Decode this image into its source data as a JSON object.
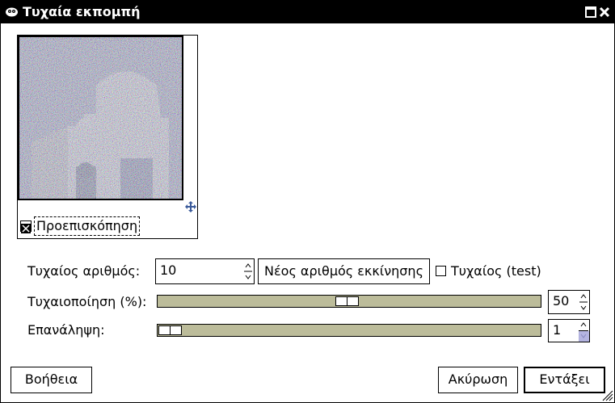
{
  "window": {
    "title": "Τυχαία εκπομπή"
  },
  "preview": {
    "label": "Προεπισκόπηση",
    "checked": true
  },
  "seed": {
    "label": "Τυχαίος αριθμός:",
    "value": "10",
    "new_seed_label": "Νέος αριθμός εκκίνησης",
    "randomize_label": "Τυχαίος (test)",
    "randomize_checked": false
  },
  "randomization": {
    "label": "Τυχαιοποίηση (%):",
    "value": "50",
    "level_percent": 50
  },
  "repeat": {
    "label": "Επανάληψη:",
    "value": "1",
    "min": 1,
    "max": 100
  },
  "buttons": {
    "help": "Βοήθεια",
    "cancel": "Ακύρωση",
    "ok": "Εντάξει"
  },
  "colors": {
    "slider_trough": "#bcbc9a",
    "titlebar": "#000000",
    "spin_highlight": "#b4b4e0"
  },
  "icons": {
    "app": "gimp-icon",
    "maximize": "maximize-icon",
    "close": "close-icon",
    "navigate": "navigate-icon",
    "grip": "resize-grip-icon"
  }
}
